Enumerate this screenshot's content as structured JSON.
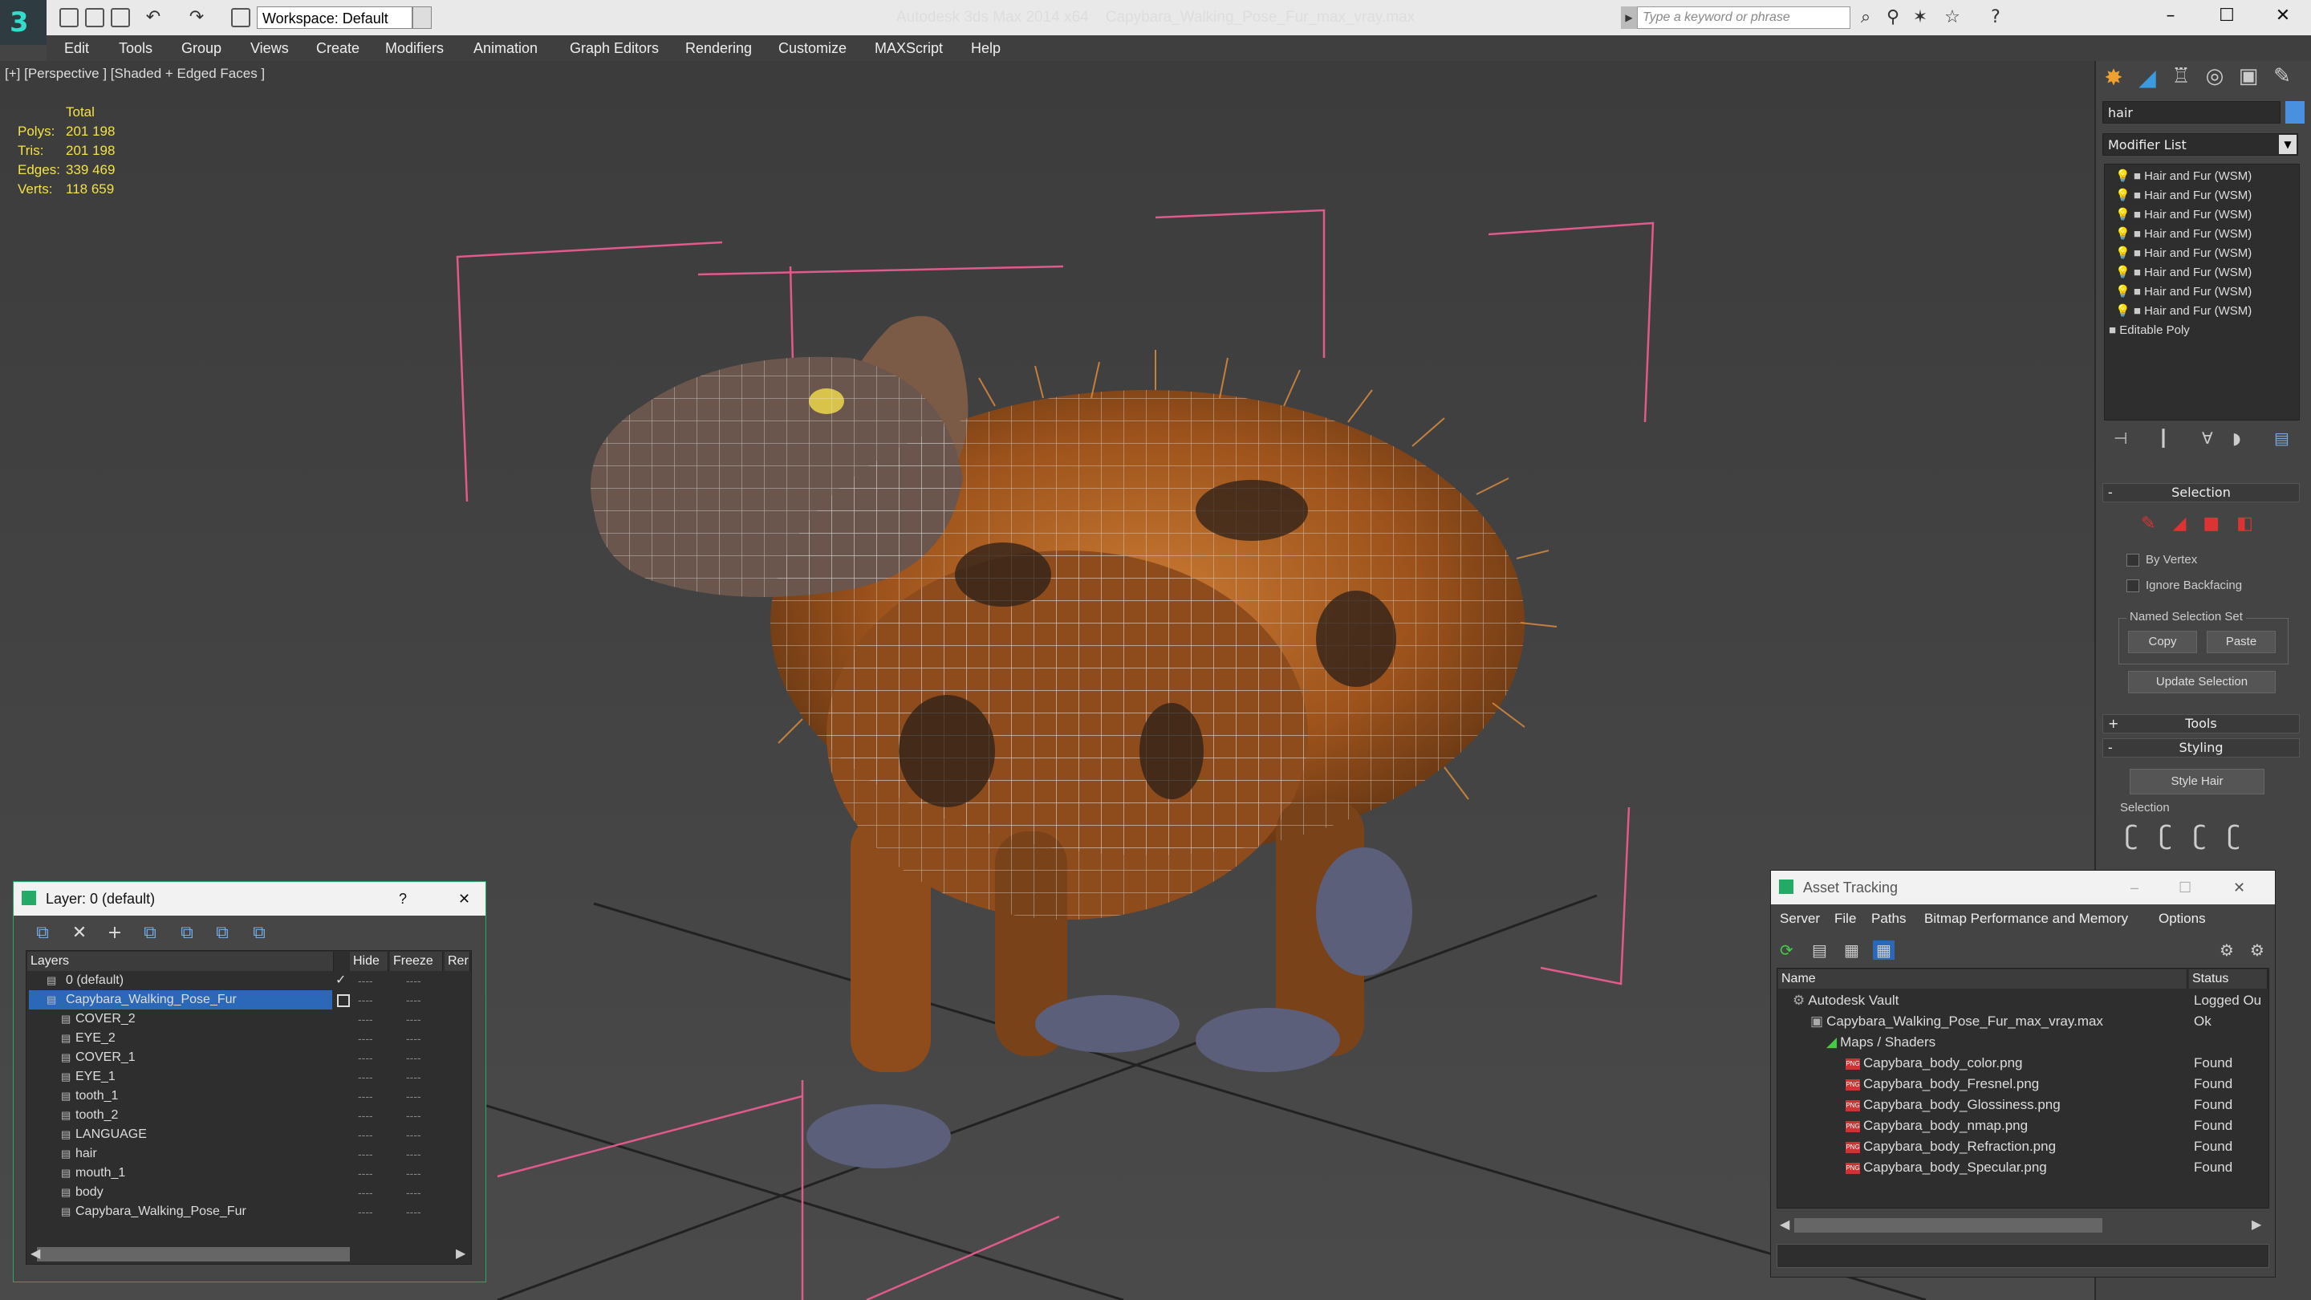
{
  "titlebar": {
    "app_title": "Autodesk 3ds Max  2014 x64",
    "file_title": "Capybara_Walking_Pose_Fur_max_vray.max",
    "workspace": "Workspace: Default",
    "search_placeholder": "Type a keyword or phrase"
  },
  "menu": [
    "Edit",
    "Tools",
    "Group",
    "Views",
    "Create",
    "Modifiers",
    "Animation",
    "Graph Editors",
    "Rendering",
    "Customize",
    "MAXScript",
    "Help"
  ],
  "viewport": {
    "label": "[+] [Perspective ] [Shaded + Edged Faces ]",
    "stats": {
      "header": "Total",
      "rows": [
        {
          "label": "Polys:",
          "value": "201 198"
        },
        {
          "label": "Tris:",
          "value": "201 198"
        },
        {
          "label": "Edges:",
          "value": "339 469"
        },
        {
          "label": "Verts:",
          "value": "118 659"
        }
      ]
    }
  },
  "command_panel": {
    "object_name": "hair",
    "modifier_list": "Modifier List",
    "stack": [
      "Hair and Fur (WSM)",
      "Hair and Fur (WSM)",
      "Hair and Fur (WSM)",
      "Hair and Fur (WSM)",
      "Hair and Fur (WSM)",
      "Hair and Fur (WSM)",
      "Hair and Fur (WSM)",
      "Hair and Fur (WSM)",
      "Editable Poly"
    ],
    "selection_title": "Selection",
    "by_vertex": "By Vertex",
    "ignore_backfacing": "Ignore Backfacing",
    "named_sel_set": "Named Selection Set",
    "copy": "Copy",
    "paste": "Paste",
    "update_selection": "Update Selection",
    "tools_title": "Tools",
    "styling_title": "Styling",
    "style_hair": "Style Hair",
    "styling_selection": "Selection",
    "tools_sign": "+",
    "minus_sign": "-"
  },
  "layer_dialog": {
    "title": "Layer: 0 (default)",
    "help": "?",
    "close": "✕",
    "columns": [
      "Layers",
      "Hide",
      "Freeze",
      "Rer"
    ],
    "rows": [
      {
        "name": "0 (default)",
        "indent": 1
      },
      {
        "name": "Capybara_Walking_Pose_Fur",
        "indent": 1
      },
      {
        "name": "COVER_2",
        "indent": 2
      },
      {
        "name": "EYE_2",
        "indent": 2
      },
      {
        "name": "COVER_1",
        "indent": 2
      },
      {
        "name": "EYE_1",
        "indent": 2
      },
      {
        "name": "tooth_1",
        "indent": 2
      },
      {
        "name": "tooth_2",
        "indent": 2
      },
      {
        "name": "LANGUAGE",
        "indent": 2
      },
      {
        "name": "hair",
        "indent": 2
      },
      {
        "name": "mouth_1",
        "indent": 2
      },
      {
        "name": "body",
        "indent": 2
      },
      {
        "name": "Capybara_Walking_Pose_Fur",
        "indent": 2
      }
    ],
    "dash": "----",
    "checkmark": "✓"
  },
  "asset_tracking": {
    "title": "Asset Tracking",
    "menu": [
      "Server",
      "File",
      "Paths",
      "Bitmap Performance and Memory",
      "Options"
    ],
    "columns": [
      "Name",
      "Status"
    ],
    "rows": [
      {
        "name": "Autodesk Vault",
        "status": "Logged Ou",
        "indent": 1
      },
      {
        "name": "Capybara_Walking_Pose_Fur_max_vray.max",
        "status": "Ok",
        "indent": 2
      },
      {
        "name": "Maps / Shaders",
        "status": "",
        "indent": 3
      },
      {
        "name": "Capybara_body_color.png",
        "status": "Found",
        "indent": 4
      },
      {
        "name": "Capybara_body_Fresnel.png",
        "status": "Found",
        "indent": 4
      },
      {
        "name": "Capybara_body_Glossiness.png",
        "status": "Found",
        "indent": 4
      },
      {
        "name": "Capybara_body_nmap.png",
        "status": "Found",
        "indent": 4
      },
      {
        "name": "Capybara_body_Refraction.png",
        "status": "Found",
        "indent": 4
      },
      {
        "name": "Capybara_body_Specular.png",
        "status": "Found",
        "indent": 4
      }
    ],
    "png_badge": "PNG"
  },
  "colors": {
    "accent_blue": "#2b68b8",
    "stat_yellow": "#f4e04a",
    "fur": "#b8651e",
    "gizmo_pink": "#e05a8c"
  }
}
